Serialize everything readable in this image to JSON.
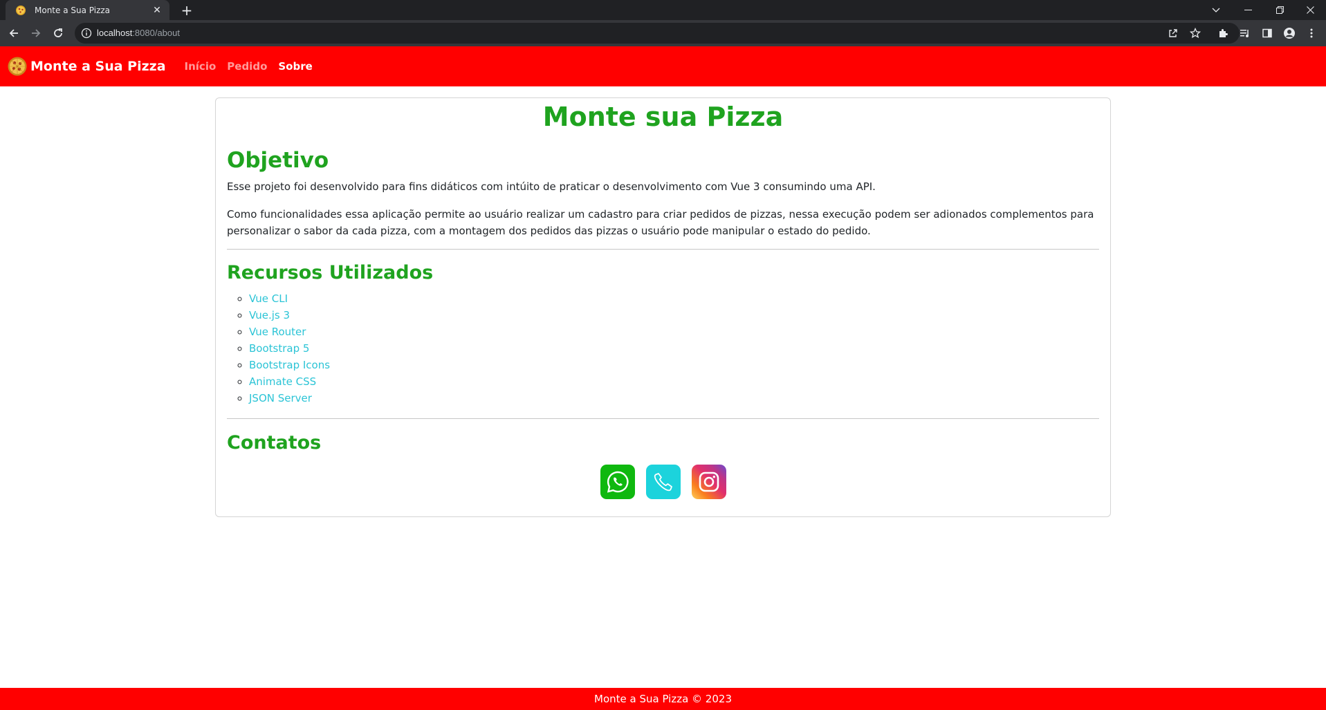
{
  "browser": {
    "tab_title": "Monte a Sua Pizza",
    "url_host": "localhost",
    "url_path": ":8080/about",
    "icons": [
      "pizza-favicon",
      "close-icon",
      "plus-icon",
      "chevron-down-icon",
      "minimize-icon",
      "restore-icon",
      "window-close-icon",
      "back-icon",
      "forward-icon",
      "reload-icon",
      "info-icon",
      "share-icon",
      "star-icon",
      "extensions-icon",
      "media-icon",
      "side-panel-icon",
      "profile-icon",
      "menu-icon"
    ]
  },
  "navbar": {
    "brand": "Monte a Sua Pizza",
    "links": [
      {
        "label": "Início"
      },
      {
        "label": "Pedido"
      },
      {
        "label": "Sobre"
      }
    ],
    "background": "#ff0000"
  },
  "card": {
    "title": "Monte sua Pizza",
    "objective": {
      "heading": "Objetivo",
      "para1": "Esse projeto foi desenvolvido para fins didáticos com intúito de praticar o desenvolvimento com Vue 3 consumindo uma API.",
      "para2": "Como funcionalidades essa aplicação permite ao usuário realizar um cadastro para criar pedidos de pizzas, nessa execução podem ser adionados complementos para personalizar o sabor da cada pizza, com a montagem dos pedidos das pizzas o usuário pode manipular o estado do pedido."
    },
    "resources": {
      "heading": "Recursos Utilizados",
      "items": [
        "Vue CLI",
        "Vue.js 3",
        "Vue Router",
        "Bootstrap 5",
        "Bootstrap Icons",
        "Animate CSS",
        "JSON Server"
      ]
    },
    "contacts": {
      "heading": "Contatos",
      "icons": [
        "whatsapp-icon",
        "phone-icon",
        "instagram-icon"
      ]
    }
  },
  "colors": {
    "accent_green": "#1fa31f",
    "link_cyan": "#2bc4d6"
  },
  "footer": {
    "text": "Monte a Sua Pizza © 2023"
  }
}
